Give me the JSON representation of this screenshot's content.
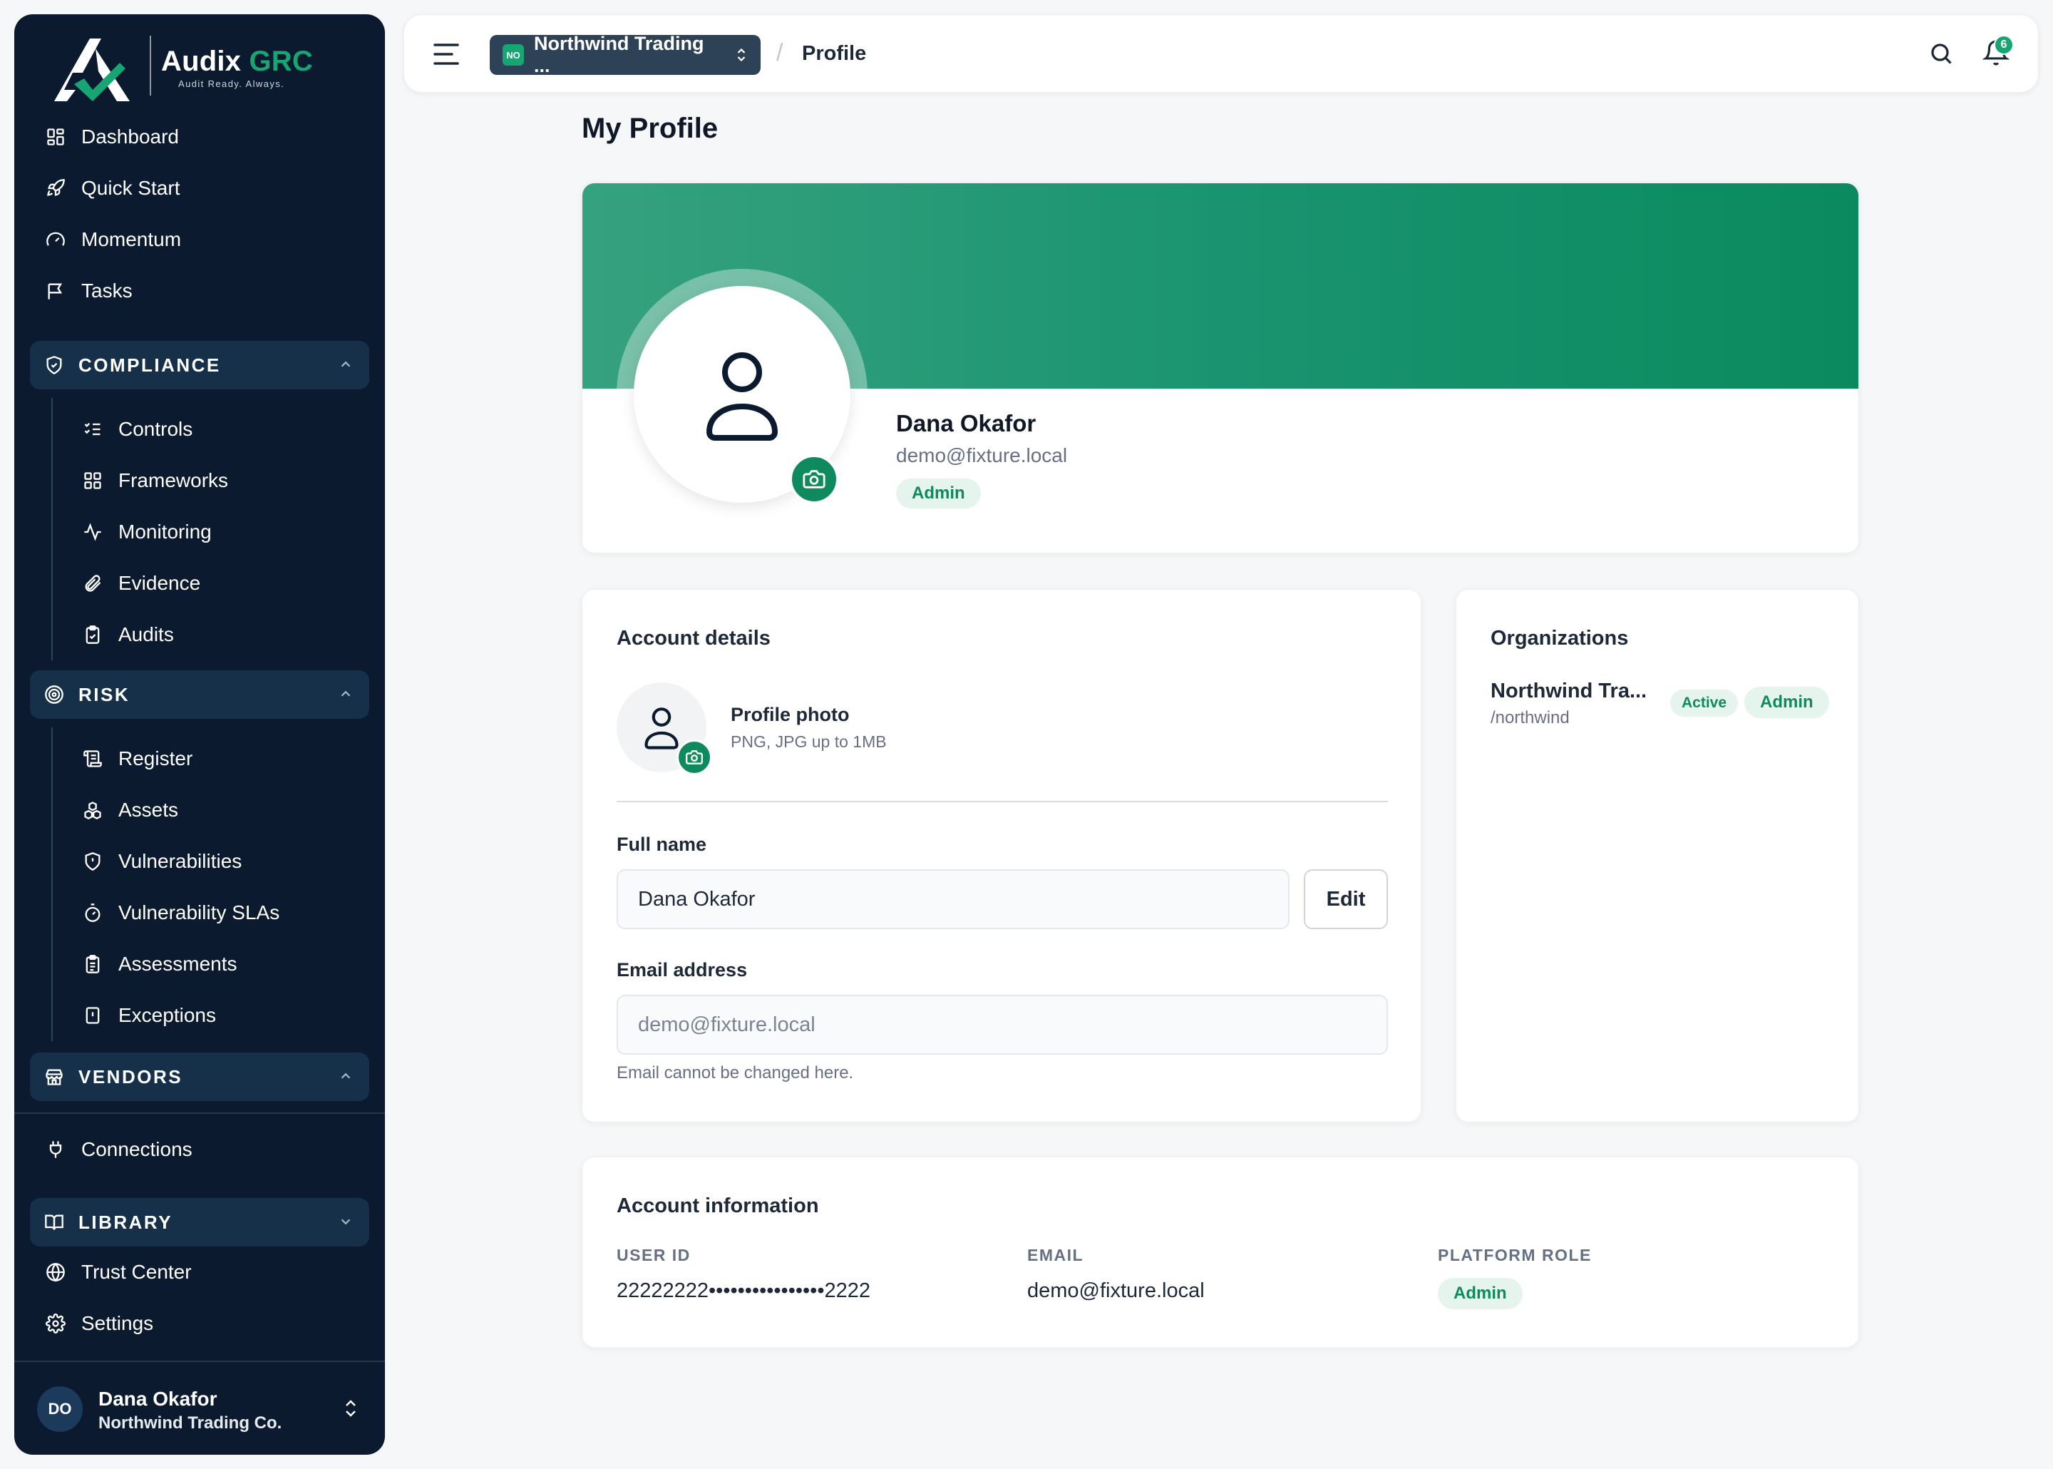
{
  "brand": {
    "name_main": "Audix",
    "name_accent": "GRC",
    "tagline": "Audit Ready. Always."
  },
  "sidebar": {
    "top_items": [
      {
        "label": "Dashboard",
        "icon": "dashboard-grid-icon"
      },
      {
        "label": "Quick Start",
        "icon": "rocket-icon"
      },
      {
        "label": "Momentum",
        "icon": "gauge-icon"
      },
      {
        "label": "Tasks",
        "icon": "flag-icon"
      }
    ],
    "compliance": {
      "label": "COMPLIANCE",
      "items": [
        {
          "label": "Controls",
          "icon": "list-checks-icon"
        },
        {
          "label": "Frameworks",
          "icon": "grid-icon"
        },
        {
          "label": "Monitoring",
          "icon": "activity-icon"
        },
        {
          "label": "Evidence",
          "icon": "paperclip-icon"
        },
        {
          "label": "Audits",
          "icon": "clipboard-check-icon"
        }
      ]
    },
    "risk": {
      "label": "RISK",
      "items": [
        {
          "label": "Register",
          "icon": "scroll-icon"
        },
        {
          "label": "Assets",
          "icon": "boxes-icon"
        },
        {
          "label": "Vulnerabilities",
          "icon": "shield-alert-icon"
        },
        {
          "label": "Vulnerability SLAs",
          "icon": "timer-icon"
        },
        {
          "label": "Assessments",
          "icon": "clipboard-list-icon"
        },
        {
          "label": "Exceptions",
          "icon": "file-alert-icon"
        }
      ]
    },
    "vendors": {
      "label": "VENDORS"
    },
    "connections": {
      "label": "Connections"
    },
    "library": {
      "label": "LIBRARY"
    },
    "bottom_items": [
      {
        "label": "Trust Center",
        "icon": "globe-icon"
      },
      {
        "label": "Settings",
        "icon": "gear-icon"
      }
    ],
    "user": {
      "initials": "DO",
      "name": "Dana Okafor",
      "org": "Northwind Trading Co."
    }
  },
  "topbar": {
    "org_badge": "NO",
    "org_name": "Northwind Trading ...",
    "breadcrumb_sep": "/",
    "breadcrumb_current": "Profile",
    "notification_count": "6"
  },
  "page": {
    "title": "My Profile"
  },
  "hero": {
    "name": "Dana Okafor",
    "email": "demo@fixture.local",
    "role": "Admin"
  },
  "account_details": {
    "title": "Account details",
    "photo_title": "Profile photo",
    "photo_hint": "PNG, JPG up to 1MB",
    "full_name_label": "Full name",
    "full_name_value": "Dana Okafor",
    "edit_label": "Edit",
    "email_label": "Email address",
    "email_value": "demo@fixture.local",
    "email_help": "Email cannot be changed here."
  },
  "organizations": {
    "title": "Organizations",
    "items": [
      {
        "name": "Northwind Tra...",
        "slug": "/northwind",
        "status": "Active",
        "role": "Admin"
      }
    ]
  },
  "account_information": {
    "title": "Account information",
    "user_id_label": "USER ID",
    "user_id_value": "22222222••••••••••••••••2222",
    "email_label": "EMAIL",
    "email_value": "demo@fixture.local",
    "role_label": "PLATFORM ROLE",
    "role_value": "Admin"
  },
  "colors": {
    "accent": "#0f8a5f",
    "sidebar_bg": "#0b1a2e",
    "section_bg": "#16304a",
    "badge_bg": "#e5f5ee"
  }
}
